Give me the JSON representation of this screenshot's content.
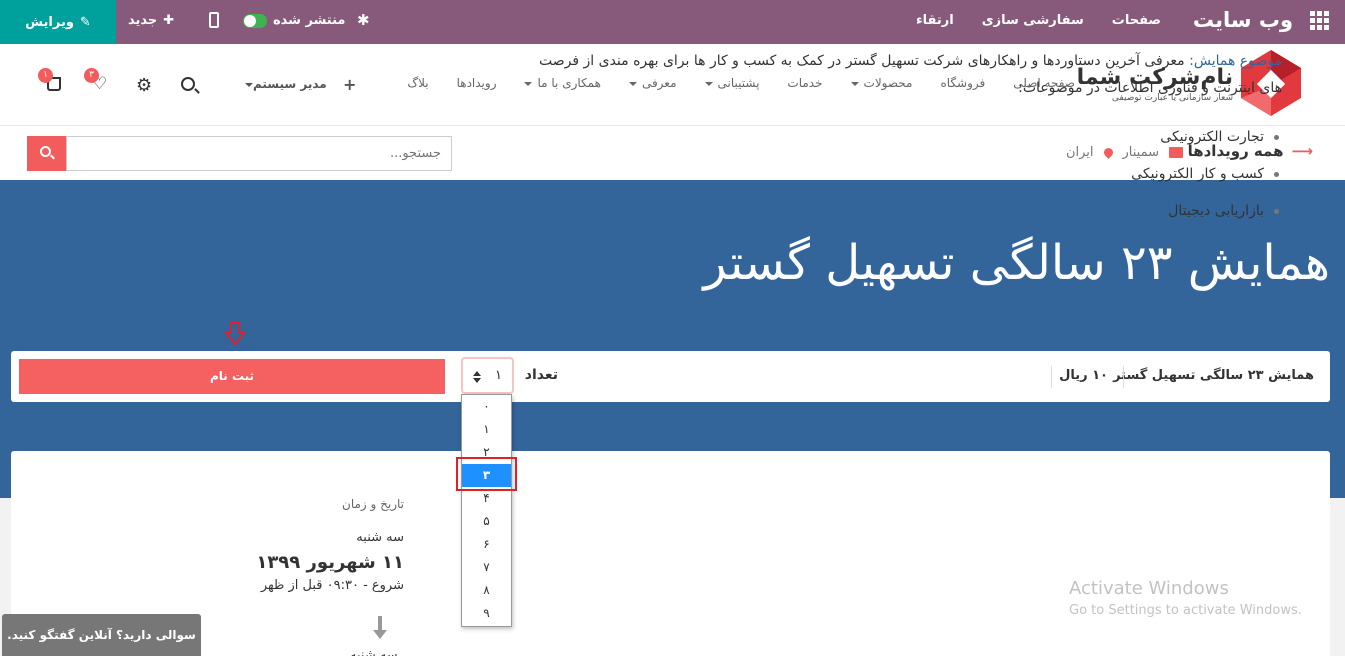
{
  "adminbar": {
    "brand": "وب سایت",
    "menu": [
      "صفحات",
      "سفارشی سازی",
      "ارتقاء"
    ],
    "edit_label": "ویرایش",
    "new_label": "جدید",
    "published_label": "منتشر شده",
    "icons": [
      "apps-grid-icon",
      "pencil-icon",
      "plus-icon",
      "mobile-icon",
      "toggle-icon",
      "bug-icon"
    ],
    "colors": {
      "bar": "#875a7b",
      "edit": "#00a09d",
      "toggle": "#3fb34f"
    }
  },
  "header": {
    "logo_title": "نام‌شرکت شما",
    "logo_subtitle": "شعار سازمانی یا عبارت توصیفی",
    "nav": [
      {
        "label": "صفحه اصلی",
        "dropdown": false
      },
      {
        "label": "فروشگاه",
        "dropdown": false
      },
      {
        "label": "محصولات",
        "dropdown": true
      },
      {
        "label": "خدمات",
        "dropdown": false
      },
      {
        "label": "پشتیبانی",
        "dropdown": true
      },
      {
        "label": "معرفی",
        "dropdown": true
      },
      {
        "label": "همکاری با ما",
        "dropdown": true
      },
      {
        "label": "رویدادها",
        "dropdown": false
      },
      {
        "label": "بلاگ",
        "dropdown": false
      }
    ],
    "add_menu": "+",
    "user_label": "مدیر سیستم",
    "wishlist_count": "۳",
    "cart_count": "۱",
    "icons": [
      "search-icon",
      "gear-icon",
      "heart-icon",
      "cart-icon"
    ]
  },
  "breadcrumb": {
    "all_events": "همه رویدادها",
    "arrow": "⟶",
    "category": "سمینار",
    "location": "ایران",
    "search_placeholder": "جستجو..."
  },
  "event": {
    "title": "همایش ۲۳ سالگی تسهیل گستر",
    "ticket_name": "همایش ۲۳ سالگی تسهیل گستر",
    "price": "۱۰ ریال",
    "quantity_label": "تعداد",
    "quantity_value": "۱",
    "quantity_options": [
      "۰",
      "۱",
      "۲",
      "۳",
      "۴",
      "۵",
      "۶",
      "۷",
      "۸",
      "۹"
    ],
    "highlighted_option": "۳",
    "register_label": "ثبت نام"
  },
  "content": {
    "topic_label": "موضوع همایش:",
    "intro": " معرفی آخرین دستاوردها و راهکارهای شرکت تسهیل گستر در کمک به کسب و کار ها برای بهره مندی از فرصت های اینترنت و فناوری اطلاعات در موضوعات:",
    "bullets": [
      "تجارت الکترونیکی",
      "کسب و کار الکترونیکی",
      "بازاریابی دیجیتال"
    ]
  },
  "datetime": {
    "label": "تاریخ و زمان",
    "weekday": "سه شنبه",
    "date": "۱۱ شهریور ۱۳۹۹",
    "start": "شروع - ۰۹:۳۰ قبل از ظهر",
    "weekday_end": "سه شنبه"
  },
  "chat": {
    "label": "سوالی دارید؟ آنلاین گفتگو کنید."
  },
  "watermark": {
    "line1": "Activate Windows",
    "line2": "Go to Settings to activate Windows."
  },
  "colors": {
    "hero": "#33659b",
    "accent": "#f25c5c",
    "selected_option": "#1e90ff"
  }
}
